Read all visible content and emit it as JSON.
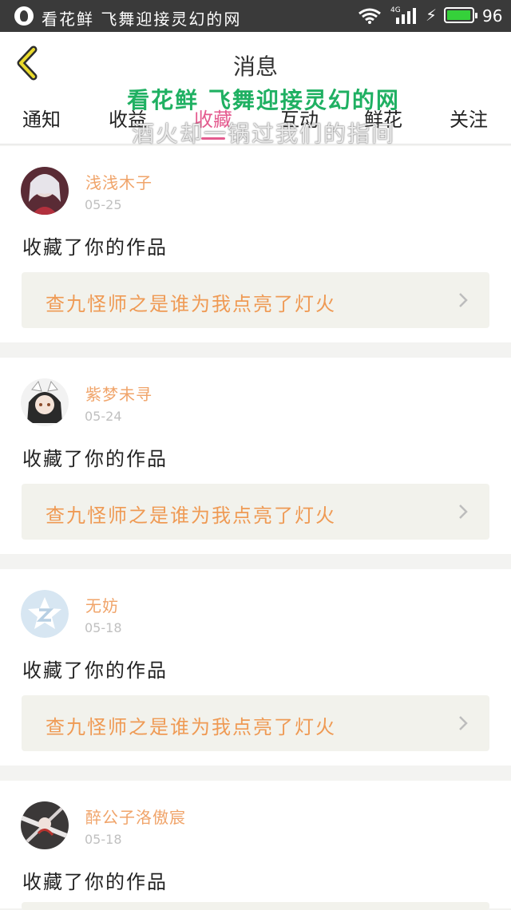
{
  "status_bar": {
    "title": "看花鲜 飞舞迎接灵幻的网",
    "network": "4G",
    "battery_text": "96",
    "battery_level": 0.96,
    "battery_color": "#35d13a"
  },
  "header": {
    "title": "消息",
    "back_icon": "chevron-left-icon"
  },
  "tabs": [
    {
      "label": "通知",
      "active": false
    },
    {
      "label": "收益",
      "active": false
    },
    {
      "label": "收藏",
      "active": true
    },
    {
      "label": "互动",
      "active": false
    },
    {
      "label": "鲜花",
      "active": false
    },
    {
      "label": "关注",
      "active": false
    }
  ],
  "watermark": {
    "line1": "看花鲜 飞舞迎接灵幻的网",
    "line2": "酒火却一锅过我们的指间"
  },
  "accent_color": "#e45b8f",
  "messages": [
    {
      "user": "浅浅木子",
      "date": "05-25",
      "action": "收藏了你的作品",
      "work": "查九怪师之是谁为我点亮了灯火"
    },
    {
      "user": "紫梦未寻",
      "date": "05-24",
      "action": "收藏了你的作品",
      "work": "查九怪师之是谁为我点亮了灯火"
    },
    {
      "user": "无妨",
      "date": "05-18",
      "action": "收藏了你的作品",
      "work": "查九怪师之是谁为我点亮了灯火"
    },
    {
      "user": "醉公子洛傲宸",
      "date": "05-18",
      "action": "收藏了你的作品",
      "work": ""
    }
  ]
}
